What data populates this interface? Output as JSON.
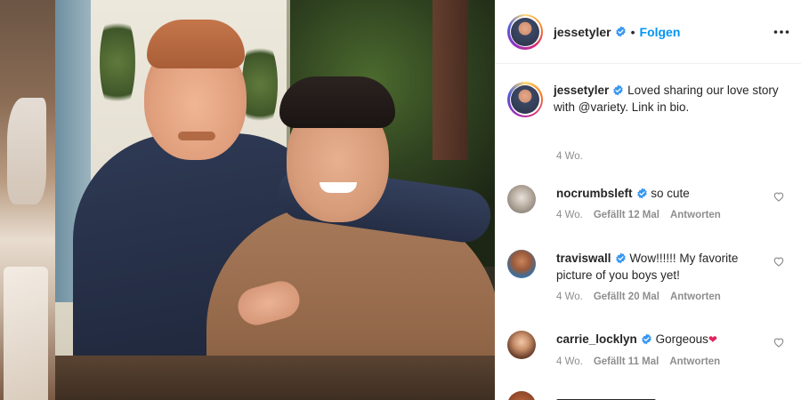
{
  "post": {
    "username": "jessetyler",
    "follow_label": "Folgen",
    "separator": "•",
    "caption_line": "Loved sharing our love story with @variety. Link in bio.",
    "caption_time": "4 Wo."
  },
  "comments": [
    {
      "username": "nocrumbsleft",
      "text": "so cute",
      "time": "4 Wo.",
      "likes": "Gefällt 12 Mal",
      "reply": "Antworten"
    },
    {
      "username": "traviswall",
      "text": "Wow!!!!!! My favorite picture of you boys yet!",
      "time": "4 Wo.",
      "likes": "Gefällt 20 Mal",
      "reply": "Antworten"
    },
    {
      "username": "carrie_locklyn",
      "text": "Gorgeous",
      "emoji": "❤",
      "time": "4 Wo.",
      "likes": "Gefällt 11 Mal",
      "reply": "Antworten"
    }
  ],
  "icons": {
    "verified": "verified-badge-icon",
    "more": "more-options-icon",
    "like": "heart-outline-icon"
  },
  "colors": {
    "accent": "#0095f6",
    "verified": "#3897f0",
    "text": "#262626",
    "muted": "#8e8e8e"
  }
}
